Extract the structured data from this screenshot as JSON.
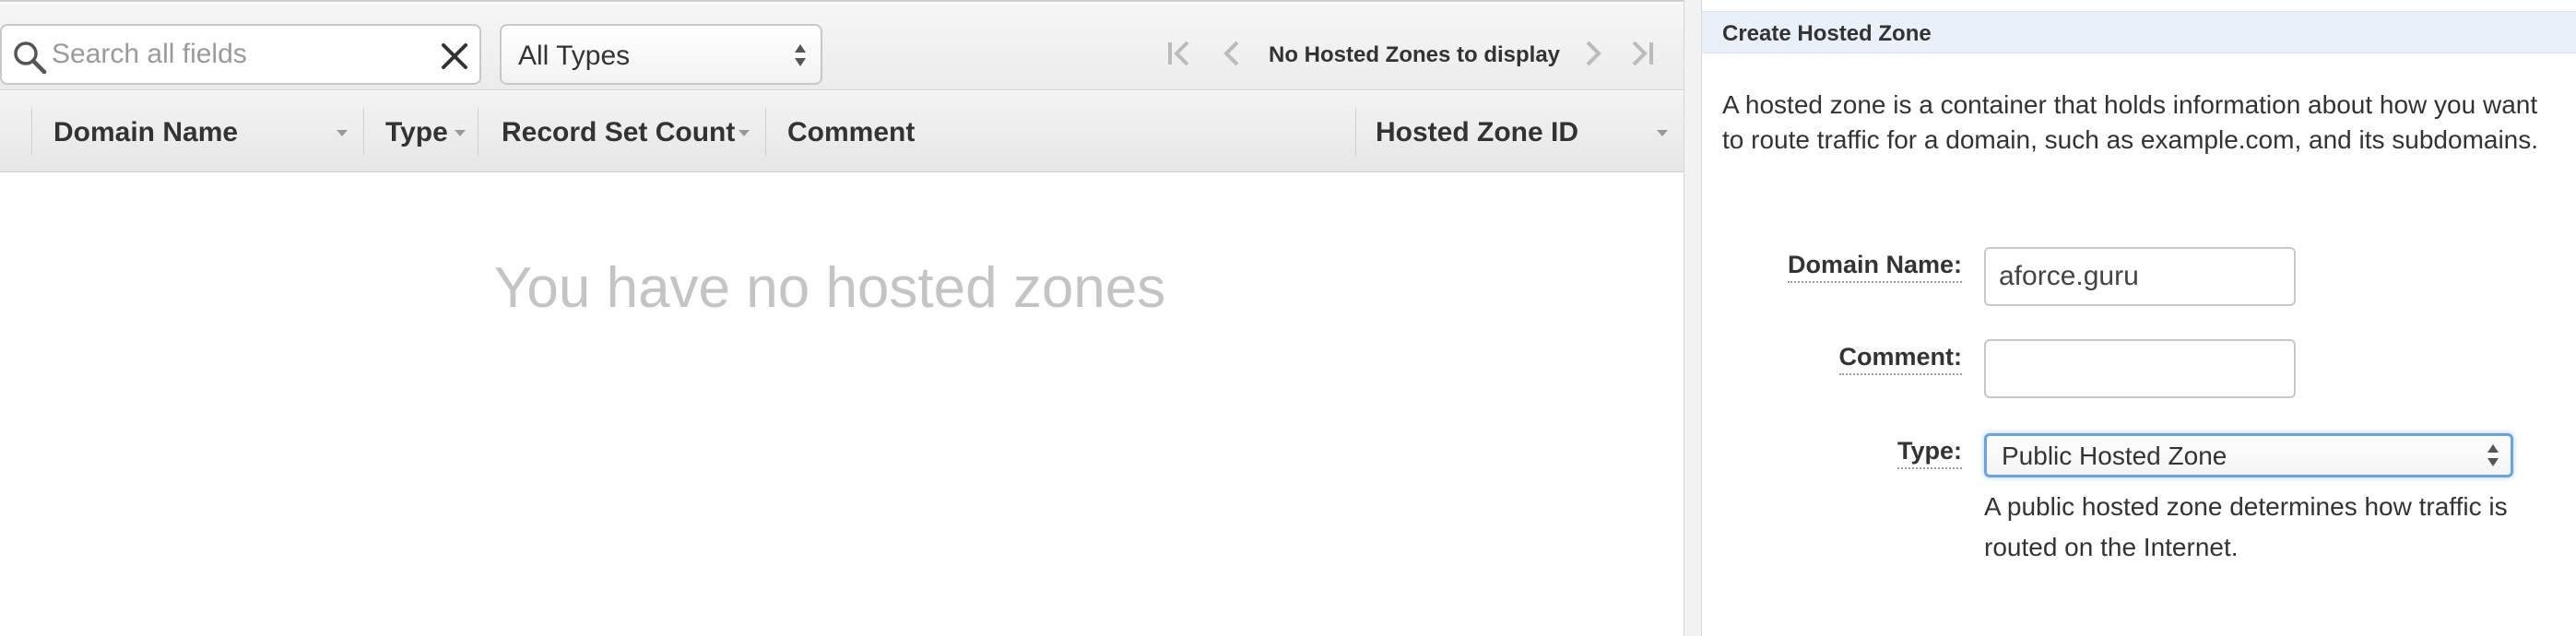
{
  "toolbar": {
    "search_placeholder": "Search all fields",
    "type_filter_value": "All Types",
    "pager_text": "No Hosted Zones to display"
  },
  "table": {
    "columns": [
      "Domain Name",
      "Type",
      "Record Set Count",
      "Comment",
      "Hosted Zone ID"
    ],
    "empty_message": "You have no hosted zones"
  },
  "create_panel": {
    "title": "Create Hosted Zone",
    "description": "A hosted zone is a container that holds information about how you want to route traffic for a domain, such as example.com, and its subdomains.",
    "domain_name_label": "Domain Name:",
    "domain_name_value": "aforce.guru",
    "comment_label": "Comment:",
    "comment_value": "",
    "type_label": "Type:",
    "type_value": "Public Hosted Zone",
    "type_help": "A public hosted zone determines how traffic is routed on the Internet."
  }
}
